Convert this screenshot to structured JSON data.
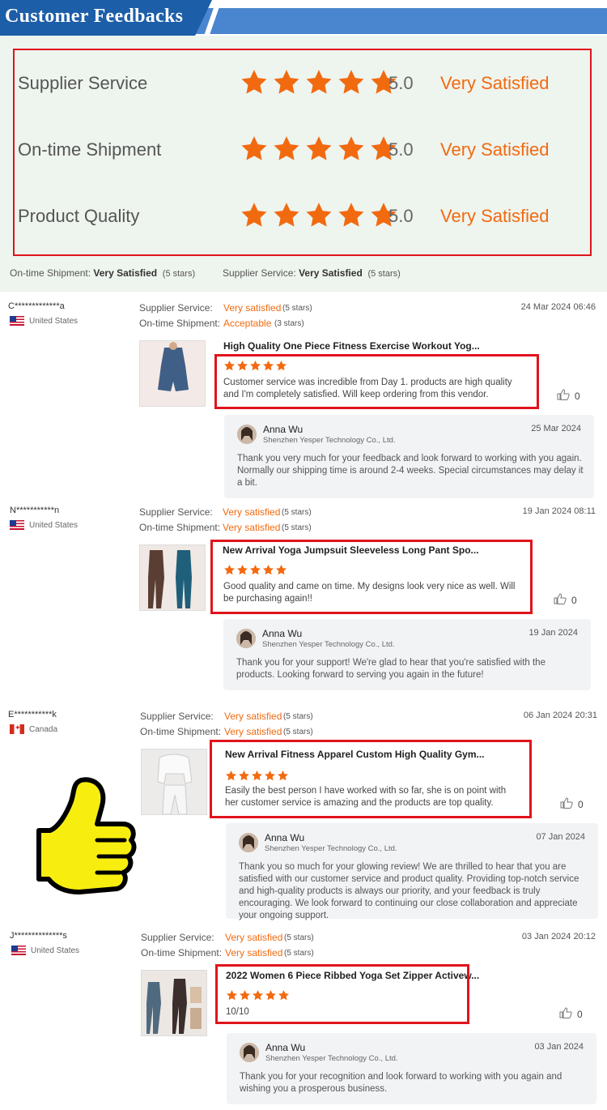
{
  "header": {
    "title": "Customer Feedbacks"
  },
  "colors": {
    "accent": "#f26a10",
    "star": "#f26a10",
    "highlight_border": "#e0141c",
    "banner": "#1c5ea8"
  },
  "summary": {
    "rows": [
      {
        "label": "Supplier Service",
        "score": "5.0",
        "rating": "Very Satisfied",
        "stars": 5
      },
      {
        "label": "On-time Shipment",
        "score": "5.0",
        "rating": "Very Satisfied",
        "stars": 5
      },
      {
        "label": "Product Quality",
        "score": "5.0",
        "rating": "Very Satisfied",
        "stars": 5
      }
    ],
    "footer": [
      {
        "label": "On-time Shipment:",
        "value": "Very Satisfied",
        "stars": "(5 stars)"
      },
      {
        "label": "Supplier Service:",
        "value": "Very Satisfied",
        "stars": "(5 stars)"
      }
    ]
  },
  "reviews": [
    {
      "name": "C*************a",
      "country": "United States",
      "flag": "us",
      "service_label": "Supplier Service:",
      "service_value": "Very satisfied",
      "service_stars": "(5 stars)",
      "shipment_label": "On-time Shipment:",
      "shipment_value": "Acceptable",
      "shipment_stars": "(3 stars)",
      "date": "24 Mar 2024 06:46",
      "product_title": "High Quality One Piece Fitness Exercise Workout Yog...",
      "text": "Customer service was incredible from Day 1. products are high quality and I'm completely satisfied. Will keep ordering from this vendor.",
      "likes": "0",
      "reply": {
        "name": "Anna Wu",
        "company": "Shenzhen Yesper Technology Co., Ltd.",
        "date": "25 Mar 2024",
        "text": "Thank you very much for your feedback and look forward to working with you again. Normally our shipping time is around 2-4 weeks. Special circumstances may delay it a bit."
      }
    },
    {
      "name": "N***********n",
      "country": "United States",
      "flag": "us",
      "service_label": "Supplier Service:",
      "service_value": "Very satisfied",
      "service_stars": "(5 stars)",
      "shipment_label": "On-time Shipment:",
      "shipment_value": "Very satisfied",
      "shipment_stars": "(5 stars)",
      "date": "19 Jan 2024 08:11",
      "product_title": "New Arrival Yoga Jumpsuit Sleeveless Long Pant Spo...",
      "text": "Good quality and came on time. My designs look very nice as well. Will be purchasing again!!",
      "likes": "0",
      "reply": {
        "name": "Anna Wu",
        "company": "Shenzhen Yesper Technology Co., Ltd.",
        "date": "19 Jan 2024",
        "text": "Thank you for your support! We're glad to hear that you're satisfied with the products. Looking forward to serving you again in the future!"
      }
    },
    {
      "name": "E***********k",
      "country": "Canada",
      "flag": "ca",
      "service_label": "Supplier Service:",
      "service_value": "Very satisfied",
      "service_stars": "(5 stars)",
      "shipment_label": "On-time Shipment:",
      "shipment_value": "Very satisfied",
      "shipment_stars": "(5 stars)",
      "date": "06 Jan 2024 20:31",
      "product_title": "New Arrival Fitness Apparel Custom High Quality Gym...",
      "text": "Easily the best person I have worked with so far, she is on point with her customer service is amazing and the products are top quality.",
      "likes": "0",
      "reply": {
        "name": "Anna Wu",
        "company": "Shenzhen Yesper Technology Co., Ltd.",
        "date": "07 Jan 2024",
        "text": "Thank you so much for your glowing review! We are thrilled to hear that you are satisfied with our customer service and product quality. Providing top-notch service and high-quality products is always our priority, and your feedback is truly encouraging. We look forward to continuing our close collaboration and appreciate your ongoing support."
      }
    },
    {
      "name": "J**************s",
      "country": "United States",
      "flag": "us",
      "service_label": "Supplier Service:",
      "service_value": "Very satisfied",
      "service_stars": "(5 stars)",
      "shipment_label": "On-time Shipment:",
      "shipment_value": "Very satisfied",
      "shipment_stars": "(5 stars)",
      "date": "03 Jan 2024 20:12",
      "product_title": "2022 Women 6 Piece Ribbed Yoga Set Zipper Activew...",
      "text": "10/10",
      "likes": "0",
      "reply": {
        "name": "Anna Wu",
        "company": "Shenzhen Yesper Technology Co., Ltd.",
        "date": "03 Jan 2024",
        "text": "Thank you for your recognition and look forward to working with you again and wishing you a prosperous business."
      }
    }
  ]
}
